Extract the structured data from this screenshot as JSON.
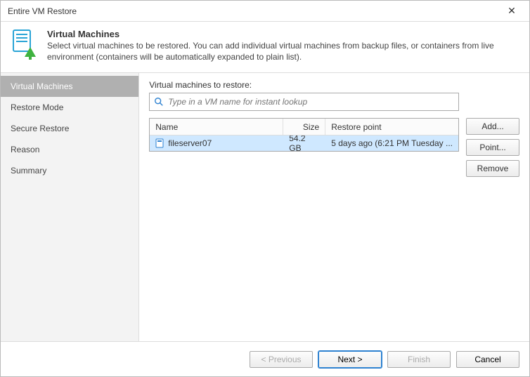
{
  "titlebar": {
    "title": "Entire VM Restore"
  },
  "header": {
    "title": "Virtual Machines",
    "desc": "Select virtual machines to be restored. You can add individual virtual machines from backup files, or containers from live environment (containers will be automatically expanded to plain list)."
  },
  "sidebar": {
    "items": [
      {
        "label": "Virtual Machines",
        "active": true
      },
      {
        "label": "Restore Mode",
        "active": false
      },
      {
        "label": "Secure Restore",
        "active": false
      },
      {
        "label": "Reason",
        "active": false
      },
      {
        "label": "Summary",
        "active": false
      }
    ]
  },
  "main": {
    "label": "Virtual machines to restore:",
    "search": {
      "placeholder": "Type in a VM name for instant lookup"
    },
    "columns": {
      "name": "Name",
      "size": "Size",
      "restore_point": "Restore point"
    },
    "rows": [
      {
        "name": "fileserver07",
        "size": "54.2 GB",
        "restore_point": "5 days ago (6:21 PM Tuesday ...",
        "selected": true
      }
    ],
    "buttons": {
      "add": "Add...",
      "point": "Point...",
      "remove": "Remove"
    }
  },
  "footer": {
    "previous": "< Previous",
    "next": "Next >",
    "finish": "Finish",
    "cancel": "Cancel"
  }
}
